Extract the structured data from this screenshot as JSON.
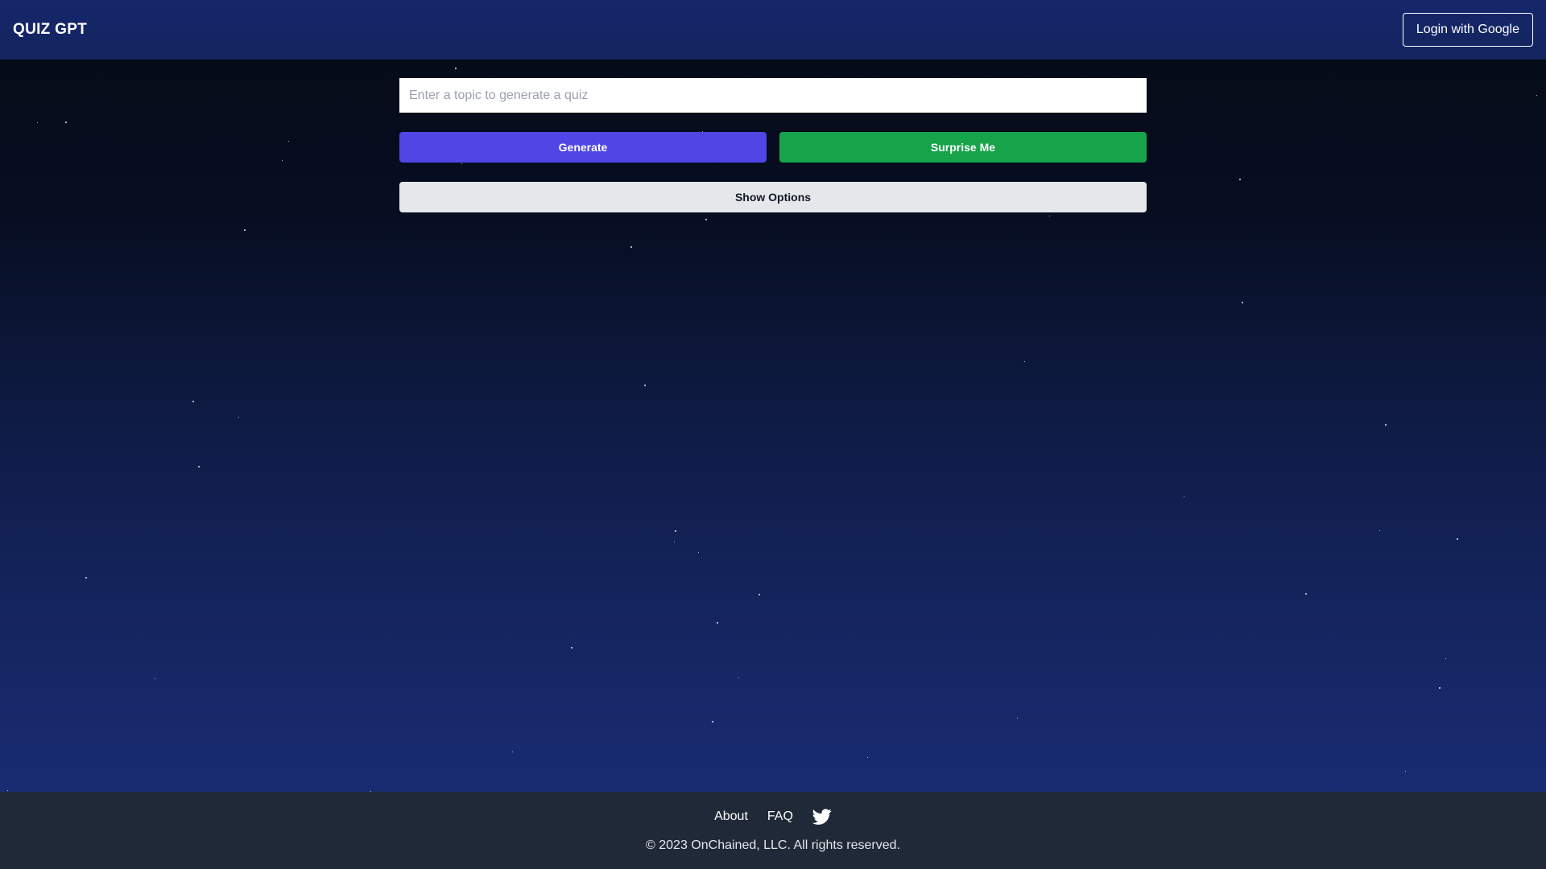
{
  "app": {
    "brand": "QUIZ GPT",
    "login_label": "Login with Google"
  },
  "main": {
    "topic_placeholder": "Enter a topic to generate a quiz",
    "topic_value": "",
    "generate_label": "Generate",
    "surprise_label": "Surprise Me",
    "options_label": "Show Options"
  },
  "footer": {
    "about_label": "About",
    "faq_label": "FAQ",
    "social_icon": "twitter-icon",
    "copyright": "© 2023 OnChained, LLC. All rights reserved."
  },
  "colors": {
    "header": "#14265f",
    "generate_button": "#4f46e5",
    "surprise_button": "#16a34a",
    "options_button": "#e5e7eb",
    "footer": "#1f2937"
  }
}
